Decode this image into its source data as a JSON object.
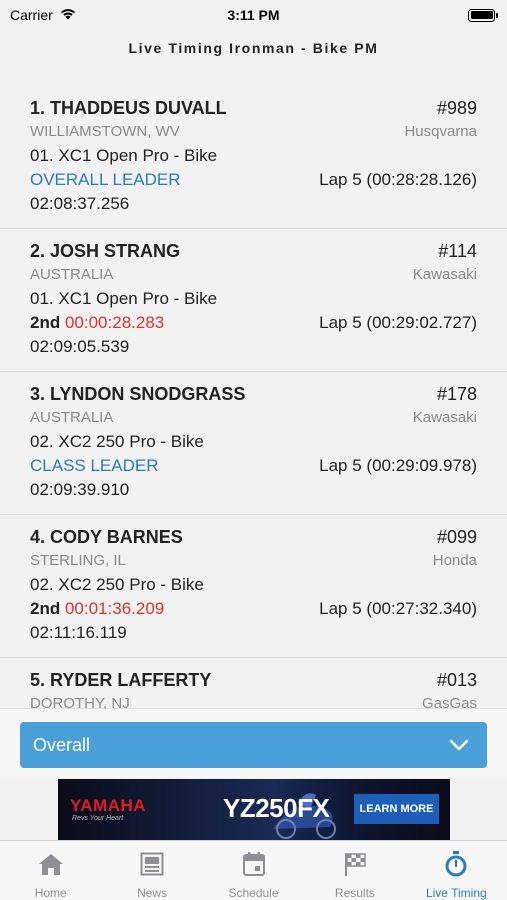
{
  "status_bar": {
    "carrier": "Carrier",
    "time": "3:11 PM"
  },
  "page": {
    "title": "Live Timing Ironman - Bike PM"
  },
  "riders": [
    {
      "position_name": "1. THADDEUS DUVALL",
      "number": "#989",
      "hometown": "WILLIAMSTOWN, WV",
      "brand": "Husqvarna",
      "class": "01. XC1 Open Pro - Bike",
      "status_type": "leader",
      "status": "OVERALL LEADER",
      "gap_label": "",
      "gap": "",
      "lap": "Lap 5 (00:28:28.126)",
      "total_time": "02:08:37.256"
    },
    {
      "position_name": "2. JOSH STRANG",
      "number": "#114",
      "hometown": "AUSTRALIA",
      "brand": "Kawasaki",
      "class": "01. XC1 Open Pro - Bike",
      "status_type": "gap",
      "status": "",
      "gap_label": "2nd",
      "gap": "00:00:28.283",
      "lap": "Lap 5 (00:29:02.727)",
      "total_time": "02:09:05.539"
    },
    {
      "position_name": "3. LYNDON SNODGRASS",
      "number": "#178",
      "hometown": "AUSTRALIA",
      "brand": "Kawasaki",
      "class": "02. XC2 250 Pro - Bike",
      "status_type": "leader",
      "status": "CLASS LEADER",
      "gap_label": "",
      "gap": "",
      "lap": "Lap 5 (00:29:09.978)",
      "total_time": "02:09:39.910"
    },
    {
      "position_name": "4. CODY BARNES",
      "number": "#099",
      "hometown": "STERLING, IL",
      "brand": "Honda",
      "class": "02. XC2 250 Pro - Bike",
      "status_type": "gap",
      "status": "",
      "gap_label": "2nd",
      "gap": "00:01:36.209",
      "lap": "Lap 5 (00:27:32.340)",
      "total_time": "02:11:16.119"
    },
    {
      "position_name": "5. RYDER LAFFERTY",
      "number": "#013",
      "hometown": "DOROTHY, NJ",
      "brand": "GasGas",
      "class": "",
      "status_type": "",
      "status": "",
      "gap_label": "",
      "gap": "",
      "lap": "",
      "total_time": ""
    }
  ],
  "filter": {
    "selected": "Overall"
  },
  "ad": {
    "brand": "YAMAHA",
    "tagline": "Revs Your Heart",
    "model": "YZ250FX",
    "cta": "LEARN MORE"
  },
  "tabs": [
    {
      "label": "Home",
      "icon": "home-icon",
      "active": false
    },
    {
      "label": "News",
      "icon": "news-icon",
      "active": false
    },
    {
      "label": "Schedule",
      "icon": "calendar-icon",
      "active": false
    },
    {
      "label": "Results",
      "icon": "checkered-flag-icon",
      "active": false
    },
    {
      "label": "Live Timing",
      "icon": "stopwatch-icon",
      "active": true
    }
  ],
  "colors": {
    "accent": "#2b7bbf",
    "dropdown": "#4a9fd8",
    "gap_red": "#e0312b",
    "ad_red": "#e21b23"
  }
}
